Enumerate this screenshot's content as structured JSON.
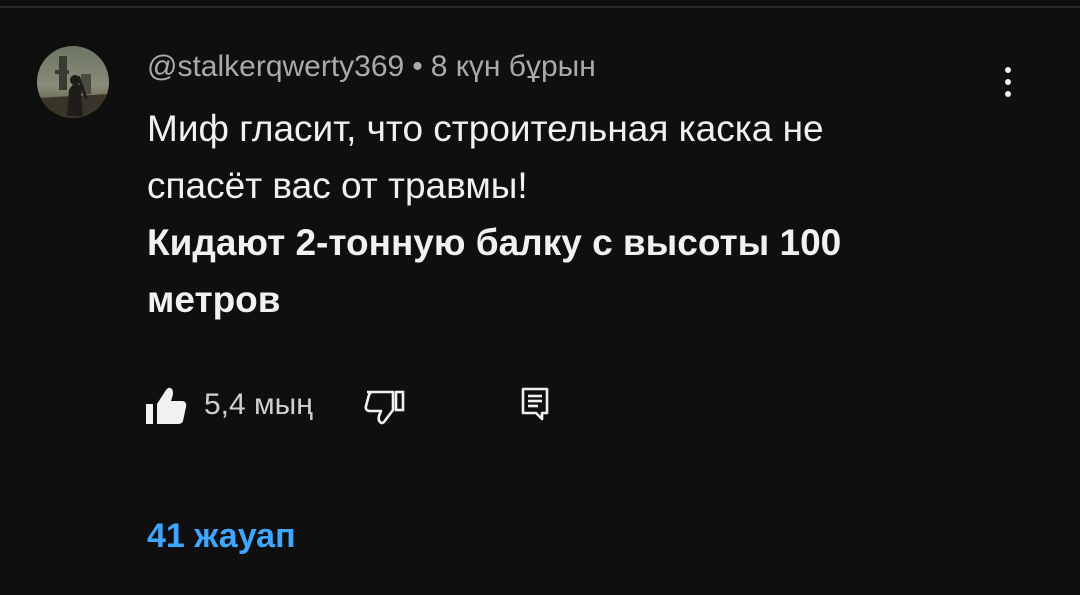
{
  "comment": {
    "author": "@stalkerqwerty369",
    "separator": "•",
    "time": "8 күн бұрын",
    "text_lines": [
      "Миф гласит, что строительная каска не",
      "спасёт вас от травмы!"
    ],
    "bold_lines": [
      "Кидают 2-тонную балку с высоты 100",
      "метров"
    ]
  },
  "actions": {
    "like_count": "5,4 мың",
    "like_icon": "thumbs-up-icon",
    "dislike_icon": "thumbs-down-icon",
    "reply_icon": "comment-reply-icon",
    "menu_icon": "more-vertical-icon"
  },
  "replies": {
    "label": "41 жауап"
  },
  "colors": {
    "background": "#0f0f0f",
    "text": "#f1f1f1",
    "secondary_text": "#aaaaaa",
    "link": "#3ea6ff"
  }
}
